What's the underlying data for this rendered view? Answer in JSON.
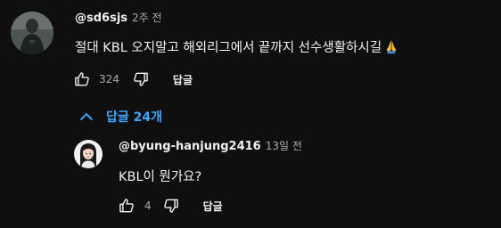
{
  "comment": {
    "author": "@sd6sjs",
    "time": "2주 전",
    "text": "절대 KBL 오지말고 해외리그에서 끝까지 선수생활하시길",
    "emoji_icon": "folded-hands-icon",
    "likes": "324",
    "reply_label": "답글"
  },
  "replies_toggle": {
    "label": "답글 24개",
    "icon": "chevron-up-icon",
    "color": "#3ea6ff"
  },
  "reply": {
    "author": "@byung-hanjung2416",
    "time": "13일 전",
    "text": "KBL이 뭔가요?",
    "likes": "4",
    "reply_label": "답글"
  },
  "colors": {
    "background": "#0f0f0f",
    "text": "#f1f1f1",
    "secondary_text": "#aaaaaa",
    "link": "#3ea6ff"
  }
}
